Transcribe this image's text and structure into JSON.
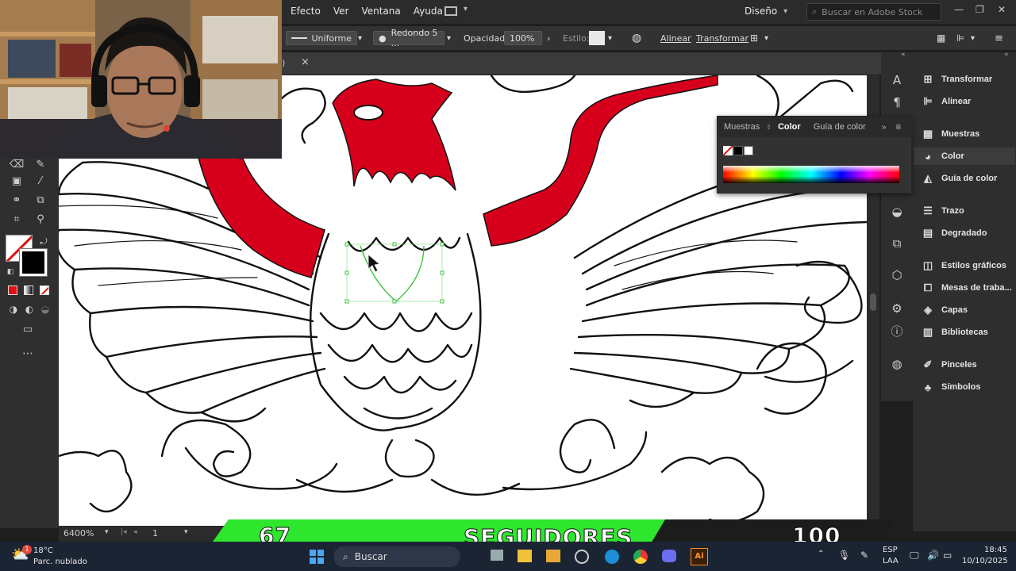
{
  "menubar": {
    "items": [
      "Efecto",
      "Ver",
      "Ventana",
      "Ayuda"
    ],
    "workspace": "Diseño",
    "search_placeholder": "Buscar en Adobe Stock"
  },
  "controlbar": {
    "stroke_profile": "Uniforme",
    "brush": "Redondo 5 ...",
    "opacity_label": "Opacidad:",
    "opacity_value": "100%",
    "style_label": "Estilo:",
    "align_link": "Alinear",
    "transform_link": "Transformar"
  },
  "doctab": {
    "close": "×",
    "fragment": ")"
  },
  "color_panel": {
    "tabs": [
      "Muestras",
      "Color",
      "Guía de color"
    ],
    "active_tab": "Color"
  },
  "right_panel": {
    "items": [
      {
        "label": "Transformar",
        "icon": "transform-icon"
      },
      {
        "label": "Alinear",
        "icon": "align-icon"
      },
      {
        "label": "Muestras",
        "icon": "swatches-icon"
      },
      {
        "label": "Color",
        "icon": "color-icon"
      },
      {
        "label": "Guía de color",
        "icon": "color-guide-icon"
      },
      {
        "label": "Trazo",
        "icon": "stroke-icon"
      },
      {
        "label": "Degradado",
        "icon": "gradient-icon"
      },
      {
        "label": "Estilos gráficos",
        "icon": "graphic-styles-icon"
      },
      {
        "label": "Mesas de traba...",
        "icon": "artboards-icon"
      },
      {
        "label": "Capas",
        "icon": "layers-icon"
      },
      {
        "label": "Bibliotecas",
        "icon": "libraries-icon"
      },
      {
        "label": "Pinceles",
        "icon": "brushes-icon"
      },
      {
        "label": "Símbolos",
        "icon": "symbols-icon"
      }
    ],
    "active": "Color"
  },
  "statusbar": {
    "zoom": "6400%",
    "artboard": "1"
  },
  "overlay": {
    "current": "67",
    "label": "SEGUIDORES",
    "goal": "100"
  },
  "taskbar": {
    "weather_temp": "18°C",
    "weather_desc": "Parc. nublado",
    "badge": "1",
    "search": "Buscar",
    "lang1": "ESP",
    "lang2": "LAA",
    "time": "18:45",
    "date": "10/10/2025"
  },
  "colors": {
    "accent_red": "#d6001c",
    "overlay_green": "#2ee62e",
    "selection_green": "#3cc43c"
  }
}
